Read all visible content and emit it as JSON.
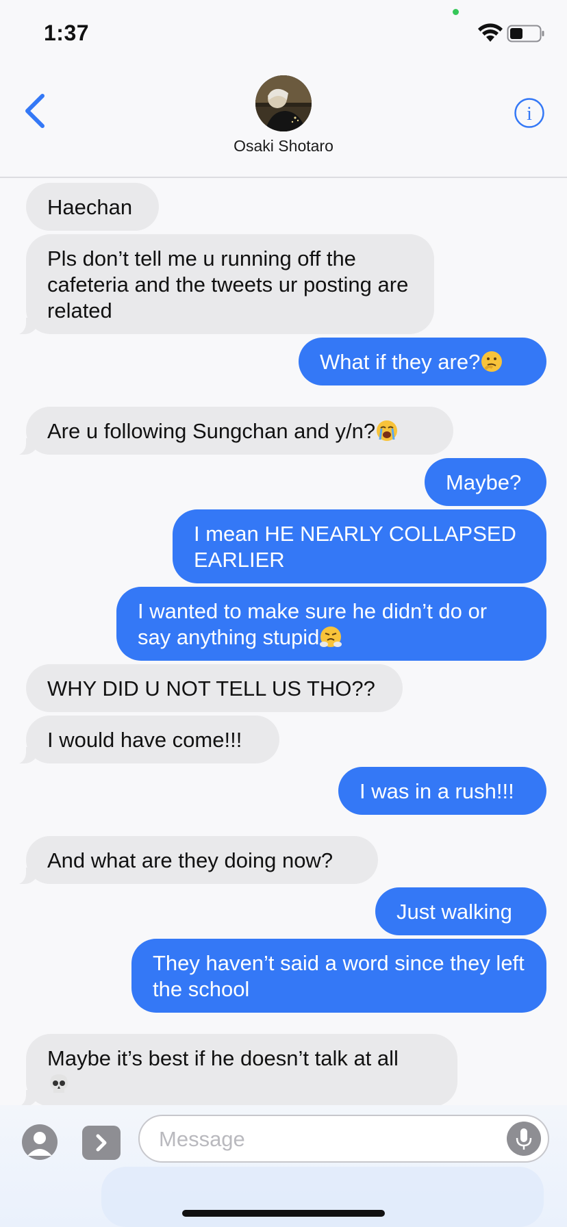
{
  "status_bar": {
    "time": "1:37",
    "battery_level": 0.45
  },
  "header": {
    "contact_name": "Osaki Shotaro"
  },
  "messages": [
    {
      "text": "Haechan"
    },
    {
      "text": "Pls don’t tell me u running off the cafeteria and the tweets ur posting are related"
    },
    {
      "text": "What if they are?"
    },
    {
      "text": "Are u following Sungchan and y/n?"
    },
    {
      "text": "Maybe?"
    },
    {
      "text": "I mean HE NEARLY COLLAPSED EARLIER"
    },
    {
      "text": "I wanted to make sure he didn’t do or say anything stupid"
    },
    {
      "text": "WHY DID U NOT TELL US THO??"
    },
    {
      "text": "I would have come!!!"
    },
    {
      "text": "I was in a rush!!!"
    },
    {
      "text": "And what are they doing now?"
    },
    {
      "text": "Just walking"
    },
    {
      "text": "They haven’t said a word since they left the school"
    },
    {
      "text": "Maybe it’s best if he doesn’t talk at all"
    }
  ],
  "input": {
    "placeholder": "Message"
  },
  "colors": {
    "outgoing": "#3478f6",
    "incoming": "#e9e9eb",
    "accent": "#3478f6"
  },
  "icons": [
    "back-chevron-icon",
    "info-icon",
    "wifi-icon",
    "battery-icon",
    "contact-icon",
    "apps-icon",
    "mic-icon"
  ]
}
